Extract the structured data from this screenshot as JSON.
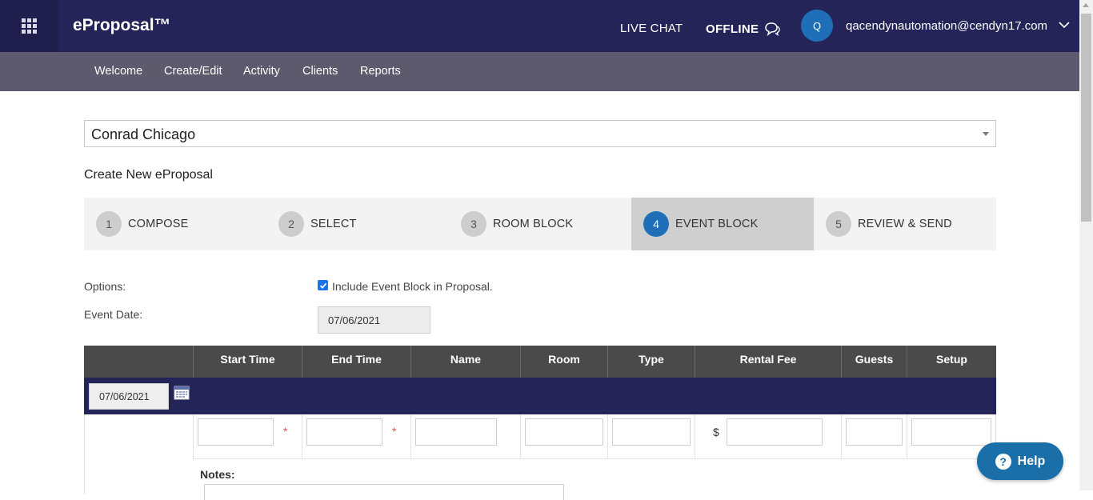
{
  "header": {
    "brand": "eProposal™",
    "live_chat": "LIVE CHAT",
    "offline": "OFFLINE",
    "avatar_initial": "Q",
    "user_email": "qacendynautomation@cendyn17.com"
  },
  "nav": {
    "items": [
      {
        "label": "Welcome"
      },
      {
        "label": "Create/Edit"
      },
      {
        "label": "Activity"
      },
      {
        "label": "Clients"
      },
      {
        "label": "Reports"
      }
    ]
  },
  "hotel": {
    "selected": "Conrad Chicago"
  },
  "page": {
    "heading": "Create New eProposal"
  },
  "steps": [
    {
      "num": "1",
      "label": "COMPOSE",
      "active": false
    },
    {
      "num": "2",
      "label": "SELECT",
      "active": false
    },
    {
      "num": "3",
      "label": "ROOM BLOCK",
      "active": false
    },
    {
      "num": "4",
      "label": "EVENT BLOCK",
      "active": true
    },
    {
      "num": "5",
      "label": "REVIEW & SEND",
      "active": false
    }
  ],
  "options": {
    "options_label": "Options:",
    "include_label": "Include Event Block in Proposal.",
    "include_checked": true,
    "event_date_label": "Event Date:",
    "event_date_value": "07/06/2021"
  },
  "table": {
    "columns": [
      "Start Time",
      "End Time",
      "Name",
      "Room",
      "Type",
      "Rental Fee",
      "Guests",
      "Setup"
    ],
    "row_date": "07/06/2021",
    "required_mark": "*",
    "currency": "$",
    "notes_label": "Notes:"
  },
  "help": {
    "label": "Help"
  },
  "colors": {
    "topbar": "#252459",
    "subnav": "#5c5a6c",
    "accent": "#1e6fb8",
    "table_header": "#4a4a4a"
  }
}
